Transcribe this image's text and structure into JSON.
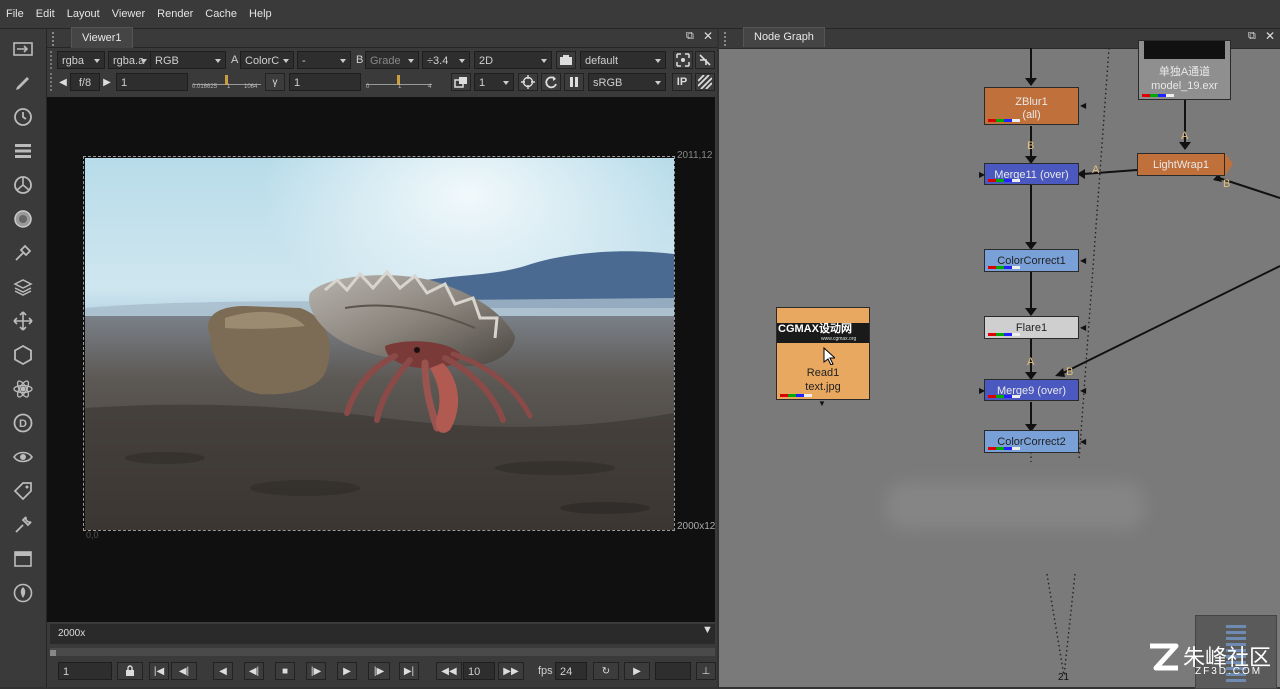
{
  "menu": [
    "File",
    "Edit",
    "Layout",
    "Viewer",
    "Render",
    "Cache",
    "Help"
  ],
  "viewer": {
    "tab": "Viewer1",
    "row1": {
      "channels": "rgba",
      "channels2": "rgba.a",
      "display": "RGB",
      "a_label": "A",
      "a_input": "ColorC",
      "dash": "-",
      "b_label": "B",
      "b_input": "Grade",
      "gain": "÷3.4",
      "mode": "2D",
      "lut_default": "default"
    },
    "row2": {
      "fstop": "f/8",
      "gain_value": "1",
      "slider_min": "0.016625",
      "slider_mid1": "1",
      "slider_mid2": "1064",
      "gamma_label": "γ",
      "gamma_value": "1",
      "g_slider_min": "0",
      "g_slider_mid": "1",
      "g_slider_max": "4",
      "proxy": "1",
      "colorspace": "sRGB",
      "ip": "IP"
    },
    "format_topright": "2011,12",
    "format_bottomright": "2000x12",
    "format_bottomleft": "0,0",
    "info_bar": "2000x"
  },
  "timeline": {
    "frame": "1",
    "step": "10",
    "fps_label": "fps",
    "fps": "24"
  },
  "nodegraph": {
    "tab": "Node Graph",
    "nodes": {
      "zblur": [
        "ZBlur1",
        "(all)"
      ],
      "merge11": "Merge11 (over)",
      "cc1": "ColorCorrect1",
      "flare": "Flare1",
      "merge9": "Merge9 (over)",
      "cc2": "ColorCorrect2",
      "lightwrap": "LightWrap1",
      "read_top": [
        "单独A通道",
        "model_19.exr"
      ],
      "read1": [
        "Read1",
        "text.jpg"
      ],
      "read1_thumb": "CGMAX设动网",
      "read1_thumb_url": "www.cgmax.org"
    },
    "labels": {
      "a": "A",
      "b": "B"
    },
    "bottom_num": "21"
  },
  "watermark": {
    "main": "朱峰社区",
    "sub": "ZF3D.COM"
  },
  "colors": {
    "zblur": "#c0703a",
    "merge": "#4a58c0",
    "cc": "#7aa0d8",
    "flare": "#cfcfcf",
    "read": "#e8a860",
    "lightwrap": "#c0703a"
  }
}
